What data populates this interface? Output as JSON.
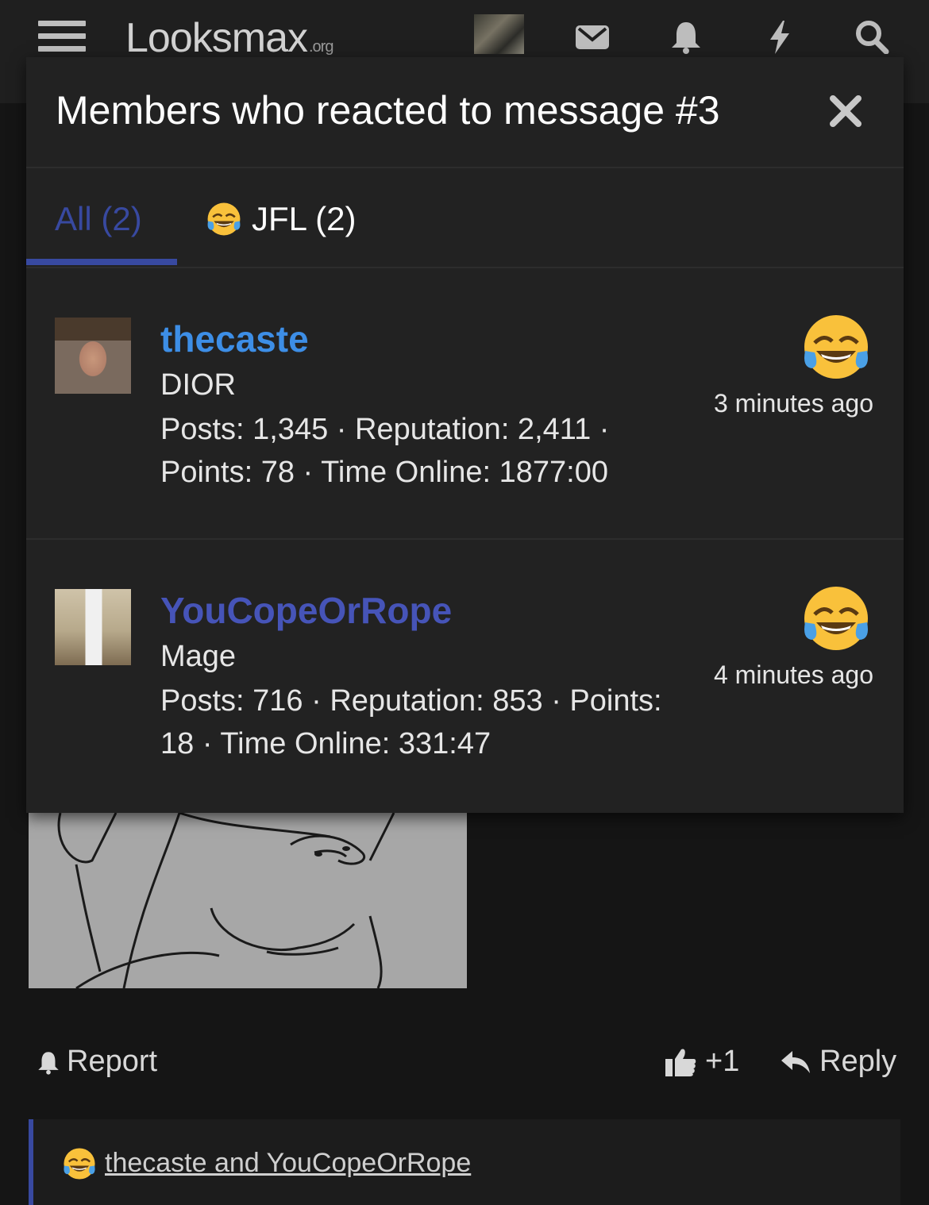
{
  "nav": {
    "logo_main": "Looksmax",
    "logo_suffix": ".org",
    "icons": [
      "menu-icon",
      "mail-icon",
      "bell-icon",
      "bolt-icon",
      "search-icon"
    ]
  },
  "modal": {
    "title": "Members who reacted to message #3",
    "tabs": [
      {
        "label": "All (2)",
        "active": true
      },
      {
        "label": "JFL (2)",
        "active": false
      }
    ],
    "members": [
      {
        "username": "thecaste",
        "user_title": "DIOR",
        "stats": "Posts: 1,345 · Reputation: 2,411 · Points: 78 · Time Online: 1877:00",
        "time": "3 minutes ago",
        "reaction_icon": "laugh-cry-emoji"
      },
      {
        "username": "YouCopeOrRope",
        "user_title": "Mage",
        "stats": "Posts: 716 · Reputation: 853 · Points: 18 · Time Online: 331:47",
        "time": "4 minutes ago",
        "reaction_icon": "laugh-cry-emoji"
      }
    ]
  },
  "post": {
    "report_label": "Report",
    "plus_one_label": "+1",
    "reply_label": "Reply",
    "reactions_summary": "thecaste and YouCopeOrRope"
  },
  "colors": {
    "accent": "#3849a0",
    "username1": "#3d8ee6",
    "username2": "#4654b8",
    "modal_bg": "#222222",
    "page_bg": "#151515"
  }
}
